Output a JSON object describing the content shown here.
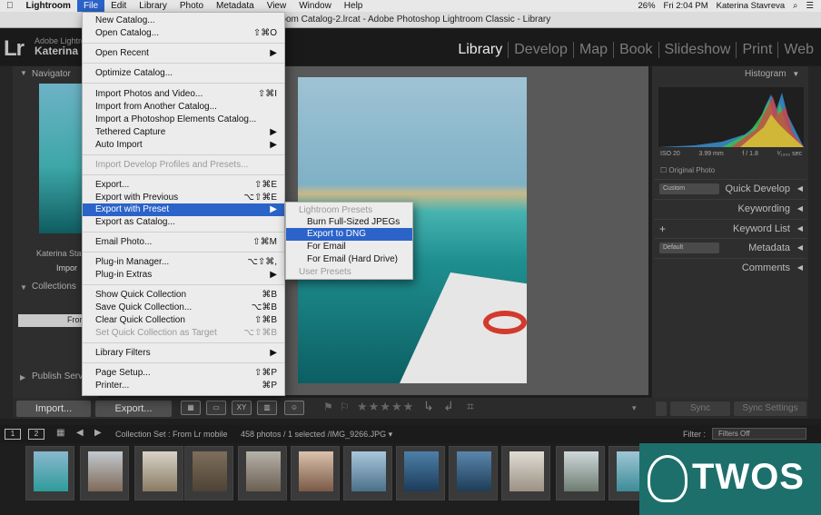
{
  "menubar": {
    "apple": "",
    "items": [
      "Lightroom",
      "File",
      "Edit",
      "Library",
      "Photo",
      "Metadata",
      "View",
      "Window",
      "Help"
    ],
    "right": {
      "battery": "26%",
      "clock": "Fri 2:04 PM",
      "user": "Katerina Stavreva"
    }
  },
  "window": {
    "title": "htroom Catalog-2.lrcat - Adobe Photoshop Lightroom Classic - Library"
  },
  "identity": {
    "logo": "Lr",
    "product": "Adobe Lightro",
    "user": "Katerina S"
  },
  "modules": [
    "Library",
    "Develop",
    "Map",
    "Book",
    "Slideshow",
    "Print",
    "Web"
  ],
  "left_panel": {
    "navigator": "Navigator",
    "catalog_user": "Katerina Stav",
    "import_item": "Impor",
    "collections": "Collections",
    "from_item": "Fror",
    "publish": "Publish Serv"
  },
  "file_menu": {
    "items": [
      {
        "label": "New Catalog...",
        "shortcut": ""
      },
      {
        "label": "Open Catalog...",
        "shortcut": "⇧⌘O"
      },
      {
        "label": "Open Recent",
        "shortcut": "▶"
      },
      {
        "label": "Optimize Catalog...",
        "shortcut": ""
      },
      {
        "label": "Import Photos and Video...",
        "shortcut": "⇧⌘I"
      },
      {
        "label": "Import from Another Catalog...",
        "shortcut": ""
      },
      {
        "label": "Import a Photoshop Elements Catalog...",
        "shortcut": ""
      },
      {
        "label": "Tethered Capture",
        "shortcut": "▶"
      },
      {
        "label": "Auto Import",
        "shortcut": "▶"
      },
      {
        "label": "Import Develop Profiles and Presets...",
        "shortcut": ""
      },
      {
        "label": "Export...",
        "shortcut": "⇧⌘E"
      },
      {
        "label": "Export with Previous",
        "shortcut": "⌥⇧⌘E"
      },
      {
        "label": "Export with Preset",
        "shortcut": "▶"
      },
      {
        "label": "Export as Catalog...",
        "shortcut": ""
      },
      {
        "label": "Email Photo...",
        "shortcut": "⇧⌘M"
      },
      {
        "label": "Plug-in Manager...",
        "shortcut": "⌥⇧⌘,"
      },
      {
        "label": "Plug-in Extras",
        "shortcut": "▶"
      },
      {
        "label": "Show Quick Collection",
        "shortcut": "⌘B"
      },
      {
        "label": "Save Quick Collection...",
        "shortcut": "⌥⌘B"
      },
      {
        "label": "Clear Quick Collection",
        "shortcut": "⇧⌘B"
      },
      {
        "label": "Set Quick Collection as Target",
        "shortcut": "⌥⇧⌘B"
      },
      {
        "label": "Library Filters",
        "shortcut": "▶"
      },
      {
        "label": "Page Setup...",
        "shortcut": "⇧⌘P"
      },
      {
        "label": "Printer...",
        "shortcut": "⌘P"
      }
    ]
  },
  "submenu": {
    "items": [
      "Lightroom Presets",
      "Burn Full-Sized JPEGs",
      "Export to DNG",
      "For Email",
      "For Email (Hard Drive)",
      "User Presets"
    ]
  },
  "histogram": {
    "title": "Histogram",
    "iso": "ISO 20",
    "focal": "3.99 mm",
    "aperture": "f / 1.8",
    "shutter": "¹⁄₁₃₀₀ sec",
    "original": "Original Photo"
  },
  "right_panel": {
    "custom": "Custom",
    "quick_develop": "Quick Develop",
    "keywording": "Keywording",
    "plus": "+",
    "keyword_list": "Keyword List",
    "default": "Default",
    "metadata": "Metadata",
    "comments": "Comments"
  },
  "toolbar": {
    "import": "Import...",
    "export": "Export...",
    "grid": "▦",
    "loupe": "▭",
    "compare": "XY",
    "survey": "▥",
    "face": "☺",
    "stars": "★★★★★",
    "sync": "Sync",
    "sync_settings": "Sync Settings"
  },
  "filmstrip": {
    "page1": "1",
    "page2": "2",
    "source": "Collection Set : From Lr mobile",
    "count": "458 photos / 1 selected /IMG_9266.JPG ▾",
    "filter_label": "Filter :",
    "filter_value": "Filters Off"
  },
  "watermark": {
    "text": "TWOS"
  },
  "colors": {
    "menu_highlight": "#2b63c9",
    "panel_bg": "#2e2e2e",
    "watermark_bg": "#1d6f6c"
  }
}
